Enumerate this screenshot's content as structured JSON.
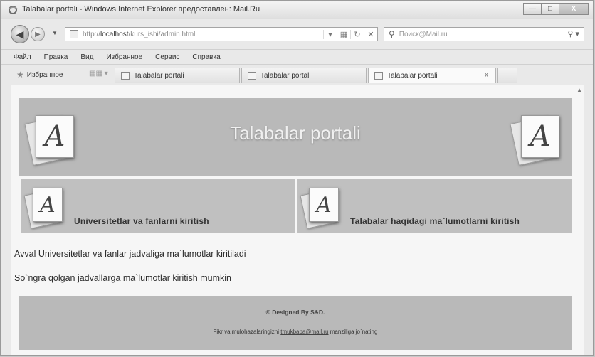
{
  "window": {
    "title": "Talabalar portali - Windows Internet Explorer предоставлен: Mail.Ru",
    "minimize": "—",
    "maximize": "□",
    "close": "X"
  },
  "addressbar": {
    "url_prefix": "http://",
    "url_host": "localhost",
    "url_path": "/kurs_ishi/admin.html",
    "search_placeholder": "Поиск@Mail.ru"
  },
  "menu": [
    "Файл",
    "Правка",
    "Вид",
    "Избранное",
    "Сервис",
    "Справка"
  ],
  "favorites": {
    "label": "Избранное",
    "tabs": [
      {
        "label": "Talabalar portali",
        "active": false
      },
      {
        "label": "Talabalar portali",
        "active": false
      },
      {
        "label": "Talabalar portali",
        "active": true,
        "close": "x"
      }
    ]
  },
  "page": {
    "banner_title": "Talabalar portali",
    "logo_letter": "A",
    "left_link": "Universitetlar va fanlarni kiritish",
    "right_link": "Talabalar haqidagi ma`lumotlarni kiritish",
    "paragraph1": "Avval Universitetlar va fanlar jadvaliga ma`lumotlar kiritiladi",
    "paragraph2": "So`ngra qolgan jadvallarga ma`lumotlar kiritish mumkin",
    "footer_credit": "© Designed By S&D.",
    "footer_contact_before": "Fikr va mulohazalaringizni",
    "footer_email": "tmukbaba@mail.ru",
    "footer_contact_after": "manziliga jo`nating"
  },
  "colors": {
    "banner_bg": "#b9b9b9",
    "panel_bg": "#c0c0c0",
    "page_bg": "#f6f6f6"
  }
}
